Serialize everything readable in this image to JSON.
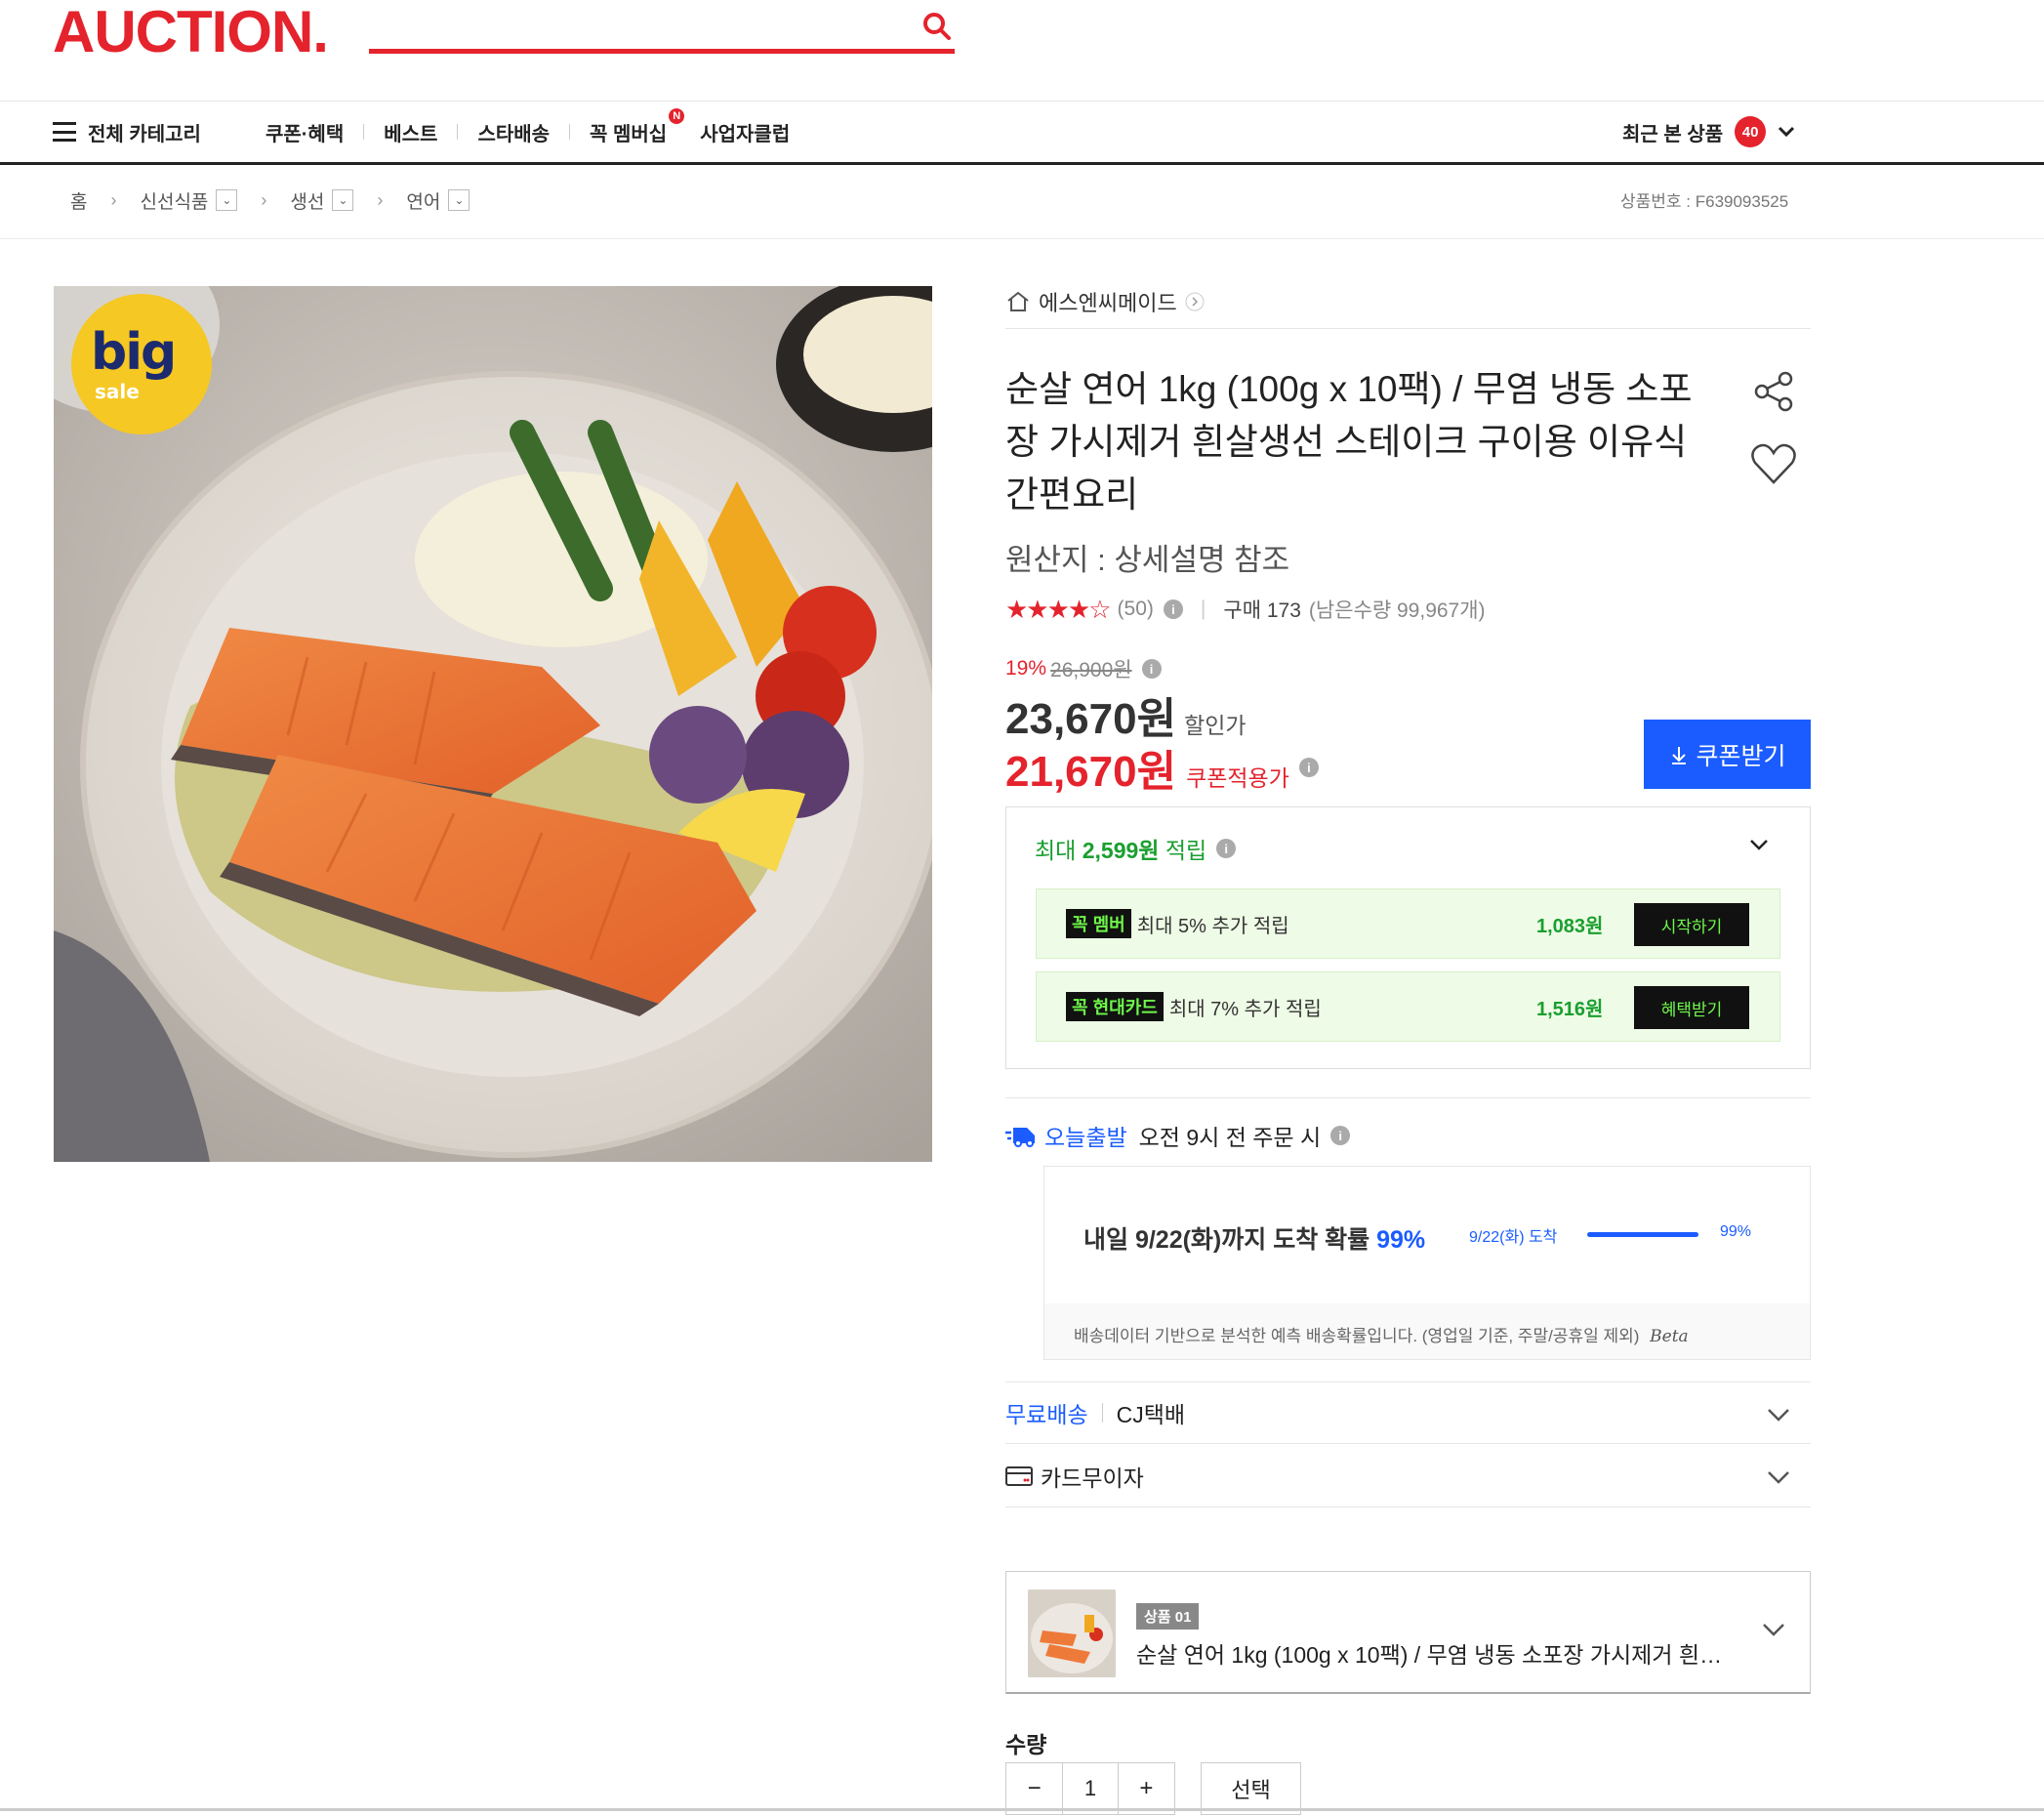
{
  "header": {
    "logo": "AUCTION.",
    "nav": [
      {
        "label": "전체 카테고리"
      },
      {
        "label": "쿠폰·혜택"
      },
      {
        "label": "베스트"
      },
      {
        "label": "스타배송"
      },
      {
        "label": "꼭 멤버십",
        "badge": "N"
      },
      {
        "label": "사업자클럽"
      }
    ],
    "recent_label": "최근 본 상품",
    "recent_count": "40"
  },
  "breadcrumb": {
    "items": [
      "홈",
      "신선식품",
      "생선",
      "연어"
    ],
    "product_no": "상품번호 : F639093525"
  },
  "hero": {
    "badge_big": "big",
    "badge_sale": "sale"
  },
  "product": {
    "seller": "에스엔씨메이드",
    "title": "순살 연어 1kg (100g x 10팩) / 무염 냉동 소포장 가시제거 흰살생선 스테이크 구이용 이유식 간편요리",
    "origin": "원산지 : 상세설명 참조",
    "stars": "★★★★☆",
    "rating": 4.5,
    "review_count": "(50)",
    "purchase": "구매 173",
    "stock": "(남은수량 99,967개)",
    "discount_pct": "19%",
    "original_price": "26,900원",
    "sale_price": "23,670원",
    "sale_label": "할인가",
    "coupon_price": "21,670원",
    "coupon_label": "쿠폰적용가",
    "coupon_button": "쿠폰받기"
  },
  "benefit": {
    "head_prefix": "최대 ",
    "head_amount": "2,599원",
    "head_suffix": " 적립",
    "rows": [
      {
        "tag1": "꼭",
        "tag2": "멤버",
        "text": "최대 5% 추가 적립",
        "amount": "1,083원",
        "button": "시작하기"
      },
      {
        "tag1": "꼭",
        "tag2": "현대카드",
        "text": "최대 7% 추가 적립",
        "amount": "1,516원",
        "button": "혜택받기"
      }
    ]
  },
  "delivery": {
    "today_label": "오늘출발",
    "today_text": "오전 9시 전 주문 시",
    "main_prefix": "내일 9/22(화)까지 도착 확률 ",
    "main_pct": "99%",
    "small_label": "9/22(화) 도착",
    "small_pct": "99%",
    "probability": 0.99,
    "note": "배송데이터 기반으로 분석한 예측 배송확률입니다. (영업일 기준, 주말/공휴일 제외)",
    "note_beta": "Beta"
  },
  "shipping": {
    "free_label": "무료배송",
    "carrier": "CJ택배",
    "card_label": "카드무이자"
  },
  "option": {
    "tag": "상품 01",
    "name": "순살 연어 1kg (100g x 10팩) / 무염 냉동 소포장 가시제거 흰살..."
  },
  "quantity": {
    "label": "수량",
    "value": "1",
    "minus": "−",
    "plus": "+",
    "select": "선택"
  },
  "colors": {
    "brand": "#e4232d",
    "blue": "#1a5cff",
    "green": "#1a9f2f"
  }
}
